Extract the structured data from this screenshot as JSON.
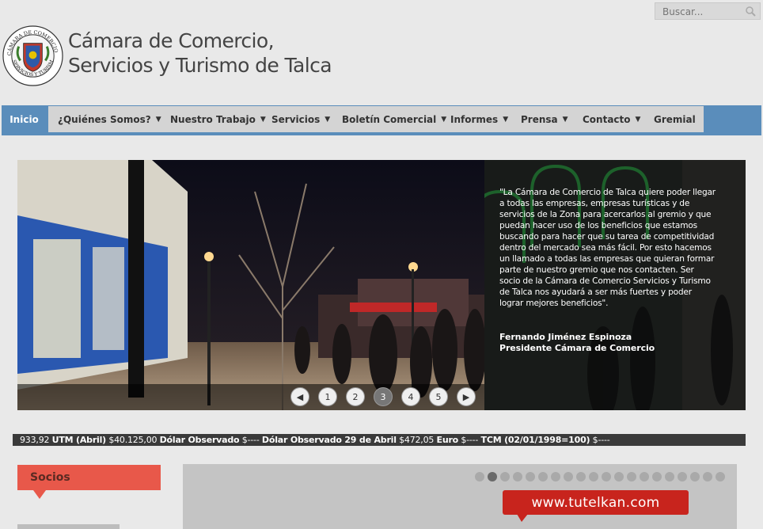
{
  "search": {
    "placeholder": "Buscar..."
  },
  "header": {
    "title_line1": "Cámara de Comercio,",
    "title_line2": "Servicios y Turismo de Talca"
  },
  "nav": [
    {
      "label": "Inicio",
      "active": true,
      "dropdown": false
    },
    {
      "label": "¿Quiénes Somos?",
      "active": false,
      "dropdown": true
    },
    {
      "label": "Nuestro Trabajo",
      "active": false,
      "dropdown": true
    },
    {
      "label": "Servicios",
      "active": false,
      "dropdown": true
    },
    {
      "label": "Boletín Comercial",
      "active": false,
      "dropdown": true
    },
    {
      "label": "Informes",
      "active": false,
      "dropdown": true
    },
    {
      "label": "Prensa",
      "active": false,
      "dropdown": true
    },
    {
      "label": "Contacto",
      "active": false,
      "dropdown": true
    },
    {
      "label": "Gremial",
      "active": false,
      "dropdown": false
    }
  ],
  "slider": {
    "quote": "\"La Cámara de Comercio de Talca quiere poder llegar a todas las empresas, empresas turísticas y de servicios de la Zona para acercarlos al gremio y que puedan hacer uso de los beneficios que estamos buscando para hacer que su tarea de competitividad dentro del mercado sea más fácil. Por esto hacemos un llamado a todas las empresas que quieran formar parte de nuestro gremio que nos contacten. Ser socio de la Cámara de Comercio Servicios y Turismo de Talca nos ayudará a ser más fuertes y poder lograr mejores beneficios\".",
    "author_name": "Fernando Jiménez Espinoza",
    "author_title": "Presidente Cámara de Comercio",
    "pages": [
      "1",
      "2",
      "3",
      "4",
      "5"
    ],
    "active_page": "3"
  },
  "ticker": {
    "text_prefix": "933,92",
    "items": [
      {
        "label": "UTM (Abril)",
        "value": "$40.125,00"
      },
      {
        "label": "Dólar Observado",
        "value": "$----"
      },
      {
        "label": "Dólar Observado 29 de Abril",
        "value": "$472,05"
      },
      {
        "label": "Euro",
        "value": "$----"
      },
      {
        "label": "TCM (02/01/1998=100)",
        "value": "$----"
      }
    ]
  },
  "socios": {
    "title": "Socios"
  },
  "banner": {
    "ad_text": "www.tutelkan.com",
    "dot_count": 20,
    "active_dot": 2
  },
  "colors": {
    "nav_blue": "#5a8dbb",
    "socios_red": "#e8584a",
    "ad_red": "#c8241d",
    "ticker_bg": "#3a3a3a"
  }
}
